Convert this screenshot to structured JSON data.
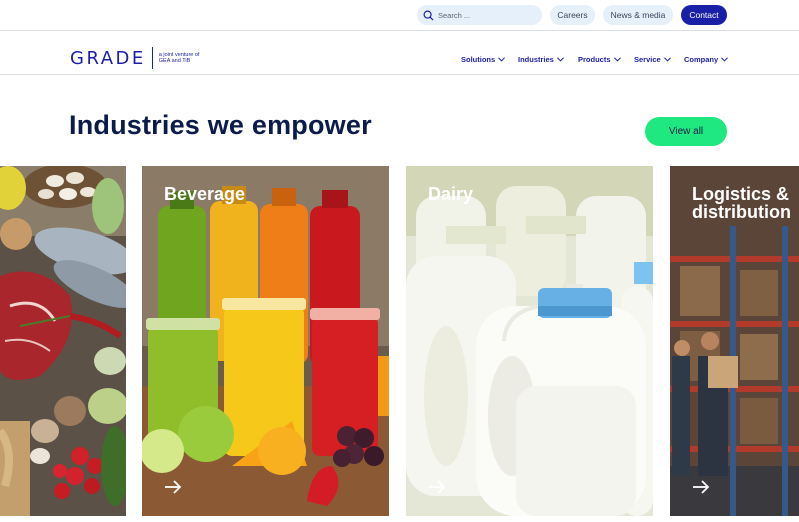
{
  "topbar": {
    "search_placeholder": "Search ...",
    "links": {
      "careers": "Careers",
      "news": "News & media",
      "contact": "Contact"
    }
  },
  "header": {
    "logo_text": "GRADE",
    "logo_tagline": "a joint venture of GEA and TiB",
    "nav": [
      "Solutions",
      "Industries",
      "Products",
      "Service",
      "Company"
    ]
  },
  "section": {
    "title": "Industries we empower",
    "view_all": "View all"
  },
  "cards": [
    {
      "label": "",
      "icon": "arrow-right-icon"
    },
    {
      "label": "Beverage",
      "icon": "arrow-right-icon"
    },
    {
      "label": "Dairy",
      "icon": "arrow-right-icon"
    },
    {
      "label": "Logistics & distribution",
      "icon": "arrow-right-icon"
    }
  ],
  "colors": {
    "brand_blue": "#1a1fa8",
    "navy_text": "#0b1b4a",
    "accent_green": "#1ee87f",
    "pill_bg": "#e6f0fa"
  }
}
